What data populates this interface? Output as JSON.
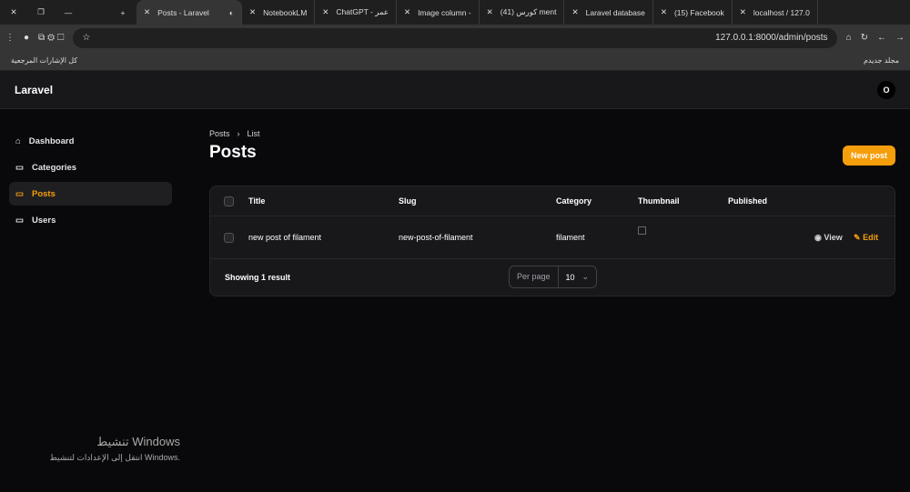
{
  "browser": {
    "tabs": [
      "Posts - Laravel",
      "NotebookLM",
      "ChatGPT - عمر",
      "Image column -",
      "كورس (41) ment",
      "Laravel database",
      "(15) Facebook",
      "localhost / 127.0"
    ],
    "url": "127.0.0.1:8000/admin/posts",
    "bookmarks_left": "كل الإشارات المرجعية",
    "bookmarks_right": "مجلد جديدم"
  },
  "app": {
    "brand": "Laravel",
    "avatar": "O"
  },
  "sidebar": {
    "items": [
      {
        "label": "Dashboard"
      },
      {
        "label": "Categories"
      },
      {
        "label": "Posts"
      },
      {
        "label": "Users"
      }
    ]
  },
  "page": {
    "breadcrumb": [
      "Posts",
      "List"
    ],
    "title": "Posts",
    "new_button": "New post"
  },
  "table": {
    "columns": [
      "Title",
      "Slug",
      "Category",
      "Thumbnail",
      "Published"
    ],
    "rows": [
      {
        "title": "new post of filament",
        "slug": "new-post-of-filament",
        "category": "filament",
        "view": "View",
        "edit": "Edit"
      }
    ],
    "showing": "Showing 1 result",
    "per_page_label": "Per page",
    "per_page": "10"
  },
  "watermark": {
    "title": "تنشيط Windows",
    "sub": "انتقل إلى الإعدادات لتنشيط Windows."
  }
}
